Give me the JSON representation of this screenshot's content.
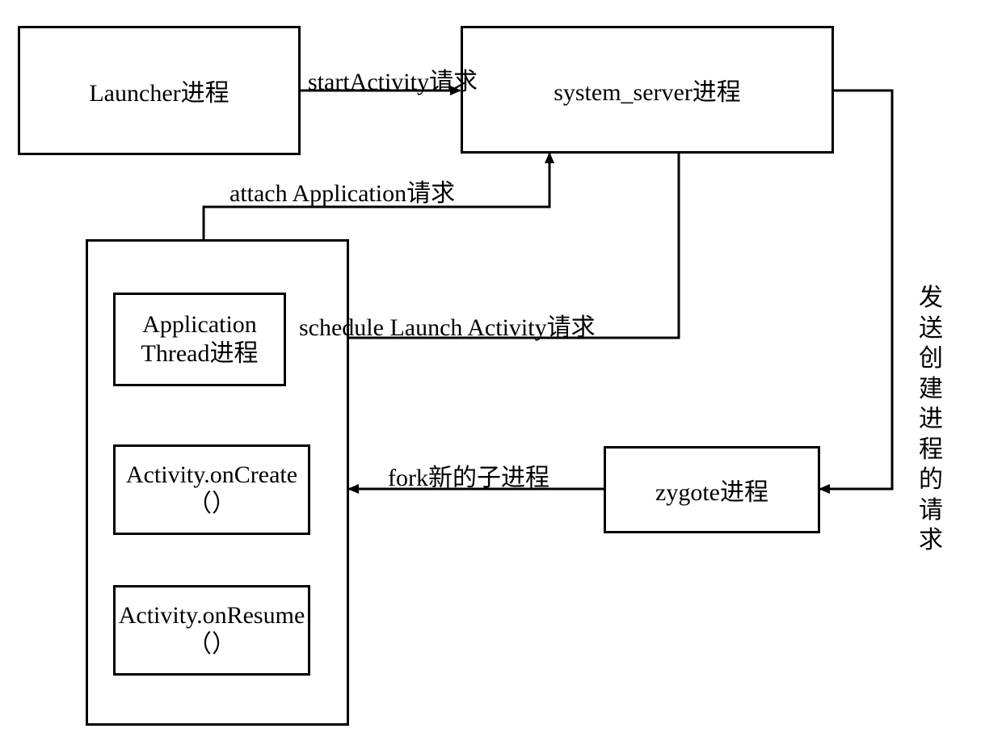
{
  "boxes": {
    "launcher": "Launcher进程",
    "system_server": "system_server进程",
    "zygote": "zygote进程",
    "app_container": "",
    "app_thread": "Application Thread进程",
    "on_create": "Activity.onCreate（）",
    "on_resume": "Activity.onResume（）"
  },
  "arrows": {
    "start_activity": "startActivity请求",
    "attach_application": "attach Application请求",
    "schedule_launch": "schedule Launch Activity请求",
    "fork_child": "fork新的子进程",
    "create_process": "发送创建进程的请求"
  }
}
